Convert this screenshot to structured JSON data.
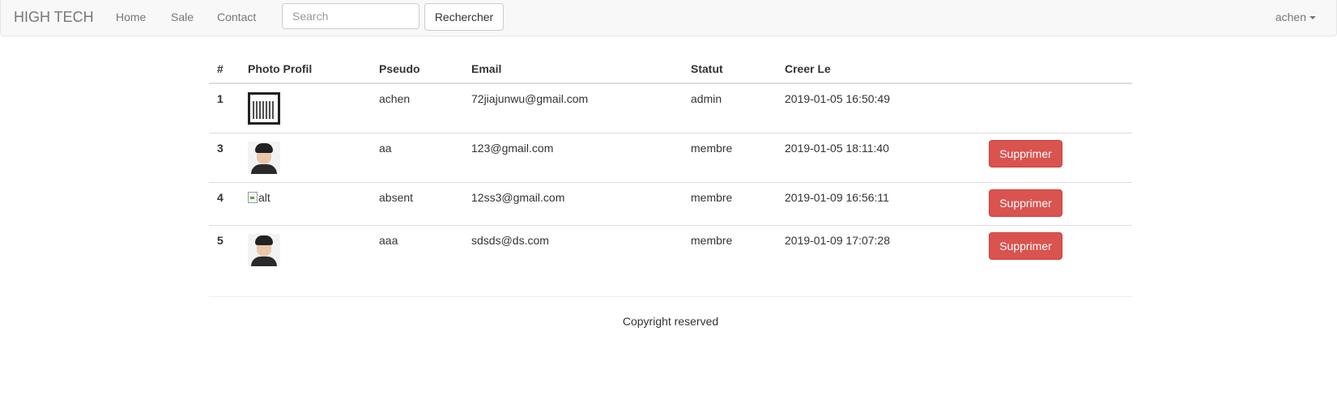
{
  "navbar": {
    "brand": "HIGH TECH",
    "links": [
      "Home",
      "Sale",
      "Contact"
    ],
    "search": {
      "placeholder": "Search",
      "value": ""
    },
    "search_button": "Rechercher",
    "user": "achen"
  },
  "table": {
    "headers": [
      "#",
      "Photo Profil",
      "Pseudo",
      "Email",
      "Statut",
      "Creer Le",
      ""
    ],
    "rows": [
      {
        "id": "1",
        "photo": "qr-code-image",
        "pseudo": "achen",
        "email": "72jiajunwu@gmail.com",
        "statut": "admin",
        "created": "2019-01-05 16:50:49",
        "action": ""
      },
      {
        "id": "3",
        "photo": "portrait-image",
        "pseudo": "aa",
        "email": "123@gmail.com",
        "statut": "membre",
        "created": "2019-01-05 18:11:40",
        "action": "Supprimer"
      },
      {
        "id": "4",
        "photo": "alt",
        "pseudo": "absent",
        "email": "12ss3@gmail.com",
        "statut": "membre",
        "created": "2019-01-09 16:56:11",
        "action": "Supprimer"
      },
      {
        "id": "5",
        "photo": "portrait-image",
        "pseudo": "aaa",
        "email": "sdsds@ds.com",
        "statut": "membre",
        "created": "2019-01-09 17:07:28",
        "action": "Supprimer"
      }
    ]
  },
  "footer": {
    "text": "Copyright reserved"
  },
  "colors": {
    "danger": "#d9534f",
    "navbar_bg": "#f8f8f8",
    "nav_text": "#777777"
  }
}
